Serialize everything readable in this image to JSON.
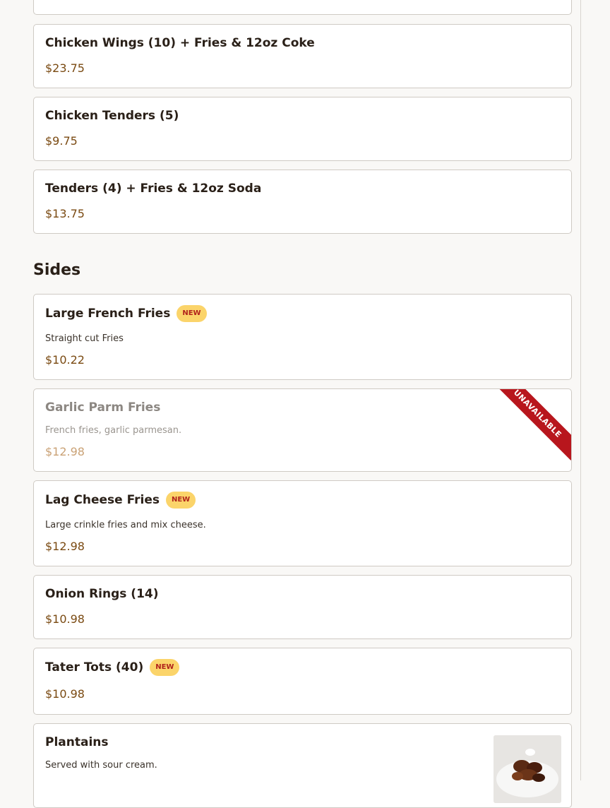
{
  "items_top": [
    {
      "name": "Chicken Wings (10) + Fries & 12oz Coke",
      "price": "$23.75"
    },
    {
      "name": "Chicken Tenders (5)",
      "price": "$9.75"
    },
    {
      "name": "Tenders (4) + Fries & 12oz Soda",
      "price": "$13.75"
    }
  ],
  "sides": {
    "title": "Sides",
    "items": [
      {
        "name": "Large French Fries",
        "badge": "NEW",
        "description": "Straight cut Fries",
        "price": "$10.22"
      },
      {
        "name": "Garlic Parm Fries",
        "ribbon": "UNAVAILABLE",
        "description": "French fries, garlic parmesan.",
        "price": "$12.98"
      },
      {
        "name": "Lag Cheese Fries",
        "badge": "NEW",
        "description": "Large crinkle fries and mix cheese.",
        "price": "$12.98"
      },
      {
        "name": "Onion Rings (14)",
        "price": "$10.98"
      },
      {
        "name": "Tater Tots (40)",
        "badge": "NEW",
        "price": "$10.98"
      },
      {
        "name": "Plantains",
        "description": "Served with sour cream."
      }
    ]
  }
}
